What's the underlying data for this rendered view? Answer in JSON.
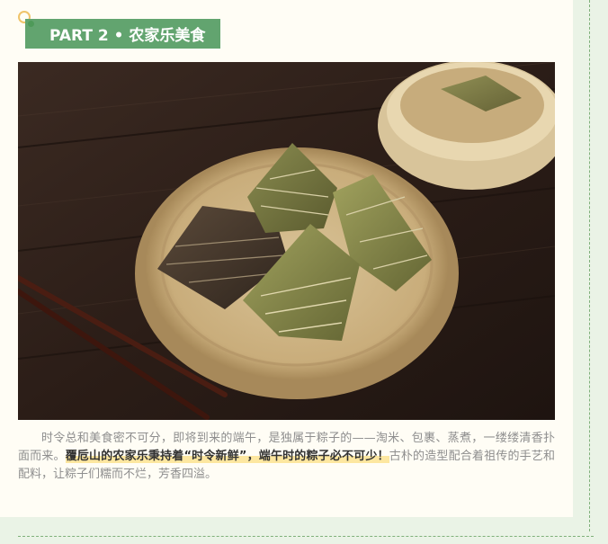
{
  "section": {
    "title": "PART 2 • 农家乐美食"
  },
  "photo": {
    "description_icon": "zongzi-photo"
  },
  "paragraph": {
    "lead": "时令总和美食密不可分，即将到来的端午，是独属于粽子的——淘米、包裹、蒸煮，一缕缕清香扑面而来。",
    "highlight": "覆卮山的农家乐秉持着“时令新鲜”，端午时的粽子必不可少！",
    "tail": "古朴的造型配合着祖传的手艺和配料，让粽子们糯而不烂，芳香四溢。"
  },
  "colors": {
    "background": "#eaf3e6",
    "card": "#fffdf5",
    "title_bar": "#62a46f",
    "highlight": "#fde7a0",
    "ring": "#f0c46a"
  }
}
